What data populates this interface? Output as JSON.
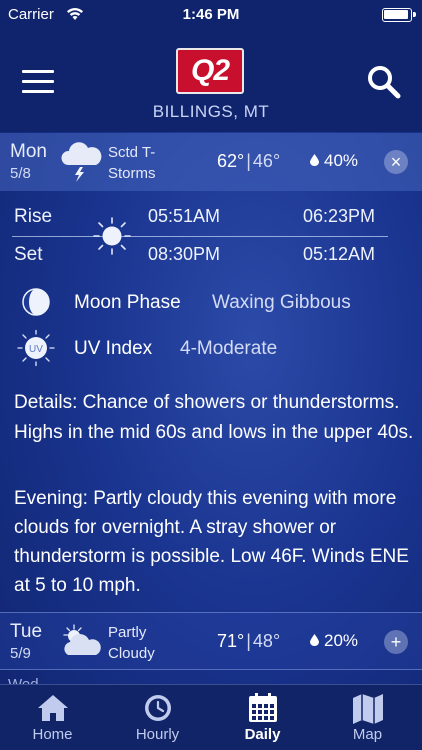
{
  "status_bar": {
    "carrier": "Carrier",
    "time": "1:46 PM"
  },
  "header": {
    "logo_text": "Q2",
    "location": "BILLINGS, MT"
  },
  "days": [
    {
      "dow": "Mon",
      "date": "5/8",
      "condition": "Sctd T-Storms",
      "condition_line1": "Sctd T-",
      "condition_line2": "Storms",
      "high": "62°",
      "separator": "|",
      "low": "46°",
      "precip": "40%",
      "toggle": "×",
      "icon": "thunderstorm-cloud-icon"
    },
    {
      "dow": "Tue",
      "date": "5/9",
      "condition_line1": "Partly",
      "condition_line2": "Cloudy",
      "high": "71°",
      "separator": "|",
      "low": "48°",
      "precip": "20%",
      "toggle": "+",
      "icon": "partly-cloudy-icon"
    }
  ],
  "sun_moon": {
    "rise_label": "Rise",
    "set_label": "Set",
    "sunrise": "05:51AM",
    "sunset": "08:30PM",
    "moonrise": "06:23PM",
    "moonset": "05:12AM"
  },
  "moon_phase": {
    "label": "Moon Phase",
    "value": "Waxing Gibbous"
  },
  "uv_index": {
    "icon_text": "UV",
    "label": "UV Index",
    "value": "4-Moderate"
  },
  "details": "Details: Chance of showers or thunderstorms. Highs in the mid 60s and lows in the upper 40s.",
  "evening": "Evening: Partly cloudy this evening with more clouds for overnight. A stray shower or thunderstorm is possible. Low 46F. Winds ENE at 5 to 10 mph.",
  "next_peek": "Wed",
  "tabs": [
    {
      "label": "Home",
      "icon": "home-icon"
    },
    {
      "label": "Hourly",
      "icon": "clock-icon"
    },
    {
      "label": "Daily",
      "icon": "calendar-icon",
      "active": true
    },
    {
      "label": "Map",
      "icon": "map-icon"
    }
  ],
  "colors": {
    "background": "#1a3590",
    "header": "#10246e",
    "accent_red": "#c8102e"
  }
}
